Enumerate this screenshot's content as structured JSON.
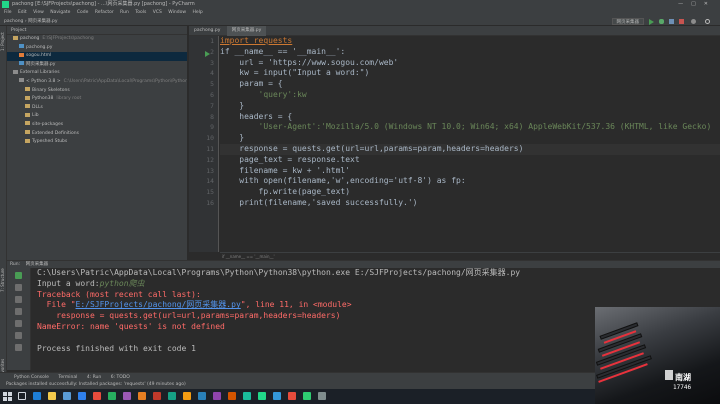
{
  "window": {
    "title": "pachong [E:\\SJFProjects\\pachong] - ...\\网页采集器.py [pachong] - PyCharm",
    "controls": [
      "—",
      "□",
      "✕"
    ]
  },
  "menu": [
    "File",
    "Edit",
    "View",
    "Navigate",
    "Code",
    "Refactor",
    "Run",
    "Tools",
    "VCS",
    "Window",
    "Help"
  ],
  "nav": {
    "breadcrumb": [
      "pachong",
      "网页采集器.py"
    ],
    "run_config": "网页采集器"
  },
  "project_panel": {
    "header": "Project",
    "items": [
      {
        "label": "pachong",
        "extra": "E:\\SJFProjects\\pachong",
        "kind": "folder",
        "indent": 1
      },
      {
        "label": "pachong.py",
        "extra": "",
        "kind": "py",
        "indent": 2
      },
      {
        "label": "sogou.html",
        "extra": "",
        "kind": "html",
        "indent": 2,
        "selected": true
      },
      {
        "label": "网页采集器.py",
        "extra": "",
        "kind": "py",
        "indent": 2
      },
      {
        "label": "External Libraries",
        "extra": "",
        "kind": "lib",
        "indent": 1
      },
      {
        "label": "< Python 3.8 >",
        "extra": "C:\\Users\\Patric\\AppData\\Local\\Programs\\Python\\Python38\\pyt",
        "kind": "lib",
        "indent": 2
      },
      {
        "label": "Binary Skeletons",
        "extra": "",
        "kind": "folder",
        "indent": 3
      },
      {
        "label": "Python38",
        "extra": "library root",
        "kind": "folder",
        "indent": 3
      },
      {
        "label": "DLLs",
        "extra": "",
        "kind": "folder",
        "indent": 3
      },
      {
        "label": "Lib",
        "extra": "",
        "kind": "folder",
        "indent": 3
      },
      {
        "label": "site-packages",
        "extra": "",
        "kind": "folder",
        "indent": 3
      },
      {
        "label": "Extended Definitions",
        "extra": "",
        "kind": "folder",
        "indent": 3
      },
      {
        "label": "Typeshed Stubs",
        "extra": "",
        "kind": "folder",
        "indent": 3
      }
    ]
  },
  "editor": {
    "tabs": [
      {
        "label": "pachong.py",
        "active": false
      },
      {
        "label": "网页采集器.py",
        "active": true
      }
    ],
    "line_numbers": [
      "1",
      "2",
      "3",
      "4",
      "5",
      "6",
      "7",
      "8",
      "9",
      "10",
      "11",
      "12",
      "13",
      "14",
      "15",
      "16"
    ],
    "lines": [
      "import requests",
      "if __name__ == '__main__':",
      "    url = 'https://www.sogou.com/web'",
      "    kw = input(\"Input a word:\")",
      "    param = {",
      "        'query':kw",
      "    }",
      "    headers = {",
      "        'User-Agent':'Mozilla/5.0 (Windows NT 10.0; Win64; x64) AppleWebKit/537.36 (KHTML, like Gecko)",
      "    }",
      "    response = quests.get(url=url,params=param,headers=headers)",
      "    page_text = response.text",
      "    filename = kw + '.html'",
      "    with open(filename,'w',encoding='utf-8') as fp:",
      "        fp.write(page_text)",
      "    print(filename,'saved successfully.')"
    ],
    "footer": "if __name__ == '__main__'"
  },
  "run_panel": {
    "header": "Run:",
    "tab": "网页采集器",
    "command": "C:\\Users\\Patric\\AppData\\Local\\Programs\\Python\\Python38\\python.exe E:/SJFProjects/pachong/网页采集器.py",
    "prompt": "Input a word:",
    "user_input": "python爬虫",
    "traceback_title": "Traceback (most recent call last):",
    "file_prefix": "  File \"",
    "file_link": "E:/SJFProjects/pachong/网页采集器.py",
    "file_suffix": "\", line 11, in <module>",
    "error_code_line": "    response = quests.get(url=url,params=param,headers=headers)",
    "error_message": "NameError: name 'quests' is not defined",
    "exit_message": "Process finished with exit code 1"
  },
  "tool_windows": [
    "Python Console",
    "Terminal",
    "4: Run",
    "6: TODO"
  ],
  "status_bar": "Packages installed successfully: Installed packages: 'requests' (49 minutes ago)",
  "webcam": {
    "watermark": "南湖",
    "counter": "17746"
  },
  "colors": {
    "keyword": "#cc7832",
    "string": "#6a8759",
    "magic": "#b200b2",
    "error": "#ff6b68",
    "link": "#5394ec"
  }
}
